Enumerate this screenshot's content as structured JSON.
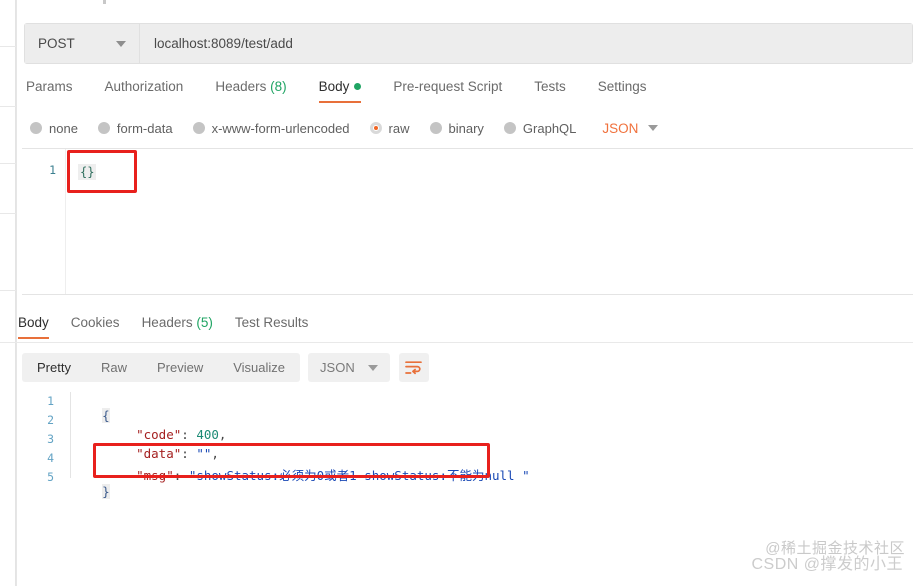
{
  "request": {
    "method": "POST",
    "url": "localhost:8089/test/add",
    "tabs": [
      {
        "label": "Params",
        "active": false,
        "count": null,
        "dot": false
      },
      {
        "label": "Authorization",
        "active": false,
        "count": null,
        "dot": false
      },
      {
        "label": "Headers",
        "active": false,
        "count": "(8)",
        "dot": false
      },
      {
        "label": "Body",
        "active": true,
        "count": null,
        "dot": true
      },
      {
        "label": "Pre-request Script",
        "active": false,
        "count": null,
        "dot": false
      },
      {
        "label": "Tests",
        "active": false,
        "count": null,
        "dot": false
      },
      {
        "label": "Settings",
        "active": false,
        "count": null,
        "dot": false
      }
    ],
    "body_types": [
      {
        "label": "none",
        "selected": false
      },
      {
        "label": "form-data",
        "selected": false
      },
      {
        "label": "x-www-form-urlencoded",
        "selected": false
      },
      {
        "label": "raw",
        "selected": true
      },
      {
        "label": "binary",
        "selected": false
      },
      {
        "label": "GraphQL",
        "selected": false
      }
    ],
    "body_format": "JSON",
    "editor": {
      "line_numbers": [
        "1"
      ],
      "content": "{}"
    }
  },
  "response": {
    "tabs": [
      {
        "label": "Body",
        "active": true,
        "count": null
      },
      {
        "label": "Cookies",
        "active": false,
        "count": null
      },
      {
        "label": "Headers",
        "active": false,
        "count": "(5)"
      },
      {
        "label": "Test Results",
        "active": false,
        "count": null
      }
    ],
    "view_modes": [
      {
        "label": "Pretty",
        "active": true
      },
      {
        "label": "Raw",
        "active": false
      },
      {
        "label": "Preview",
        "active": false
      },
      {
        "label": "Visualize",
        "active": false
      }
    ],
    "format": "JSON",
    "wrap_icon": "wrap-text-icon",
    "line_numbers": [
      "1",
      "2",
      "3",
      "4",
      "5"
    ],
    "json": {
      "code": 400,
      "data": "",
      "msg": "showStatus:必须为0或者1 showStatus:不能为null "
    },
    "lines": [
      {
        "open_brace": "{"
      },
      {
        "key": "\"code\"",
        "colon": ": ",
        "value": "400",
        "comma": ",",
        "type": "number"
      },
      {
        "key": "\"data\"",
        "colon": ": ",
        "value": "\"\"",
        "comma": ",",
        "type": "string"
      },
      {
        "key": "\"msg\"",
        "colon": ": ",
        "value": "\"showStatus:必须为0或者1 showStatus:不能为null \"",
        "comma": "",
        "type": "string"
      },
      {
        "close_brace": "}"
      }
    ]
  },
  "annotations": {
    "request_box_color": "#e8201c",
    "response_box_color": "#e8201c"
  },
  "watermarks": {
    "top": "@稀土掘金技术社区",
    "bottom": "CSDN @撑发的小王"
  }
}
